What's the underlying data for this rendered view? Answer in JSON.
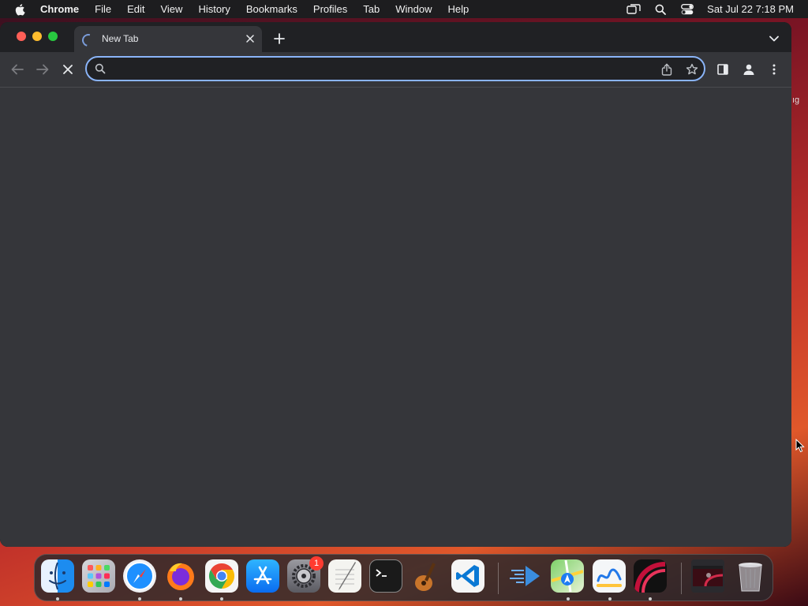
{
  "menubar": {
    "app_name": "Chrome",
    "items": [
      "File",
      "Edit",
      "View",
      "History",
      "Bookmarks",
      "Profiles",
      "Tab",
      "Window",
      "Help"
    ],
    "clock": "Sat Jul 22  7:18 PM"
  },
  "browser": {
    "tab_title": "New Tab",
    "omnibox_value": "",
    "page_state": "loading"
  },
  "desktop": {
    "edge_text": "ıg"
  },
  "dock": {
    "items": [
      {
        "name": "Finder",
        "icon": "finder-icon",
        "running": true
      },
      {
        "name": "Launchpad",
        "icon": "launchpad-icon",
        "running": false
      },
      {
        "name": "Safari",
        "icon": "safari-icon",
        "running": true
      },
      {
        "name": "Firefox",
        "icon": "firefox-icon",
        "running": true
      },
      {
        "name": "Google Chrome",
        "icon": "chrome-icon",
        "running": true
      },
      {
        "name": "App Store",
        "icon": "app-store-icon",
        "running": false
      },
      {
        "name": "System Settings",
        "icon": "system-settings-icon",
        "running": false,
        "badge": "1"
      },
      {
        "name": "TextEdit",
        "icon": "textedit-icon",
        "running": false
      },
      {
        "name": "Terminal",
        "icon": "terminal-icon",
        "running": false
      },
      {
        "name": "GarageBand",
        "icon": "garageband-icon",
        "running": false
      },
      {
        "name": "Visual Studio Code",
        "icon": "vscode-icon",
        "running": false
      },
      {
        "name": "Transloader",
        "icon": "arrow-app-icon",
        "running": false
      },
      {
        "name": "Maps",
        "icon": "maps-icon",
        "running": true
      },
      {
        "name": "Freeform",
        "icon": "freeform-icon",
        "running": true
      },
      {
        "name": "Ventura Wallpaper",
        "icon": "wallpaper-app-icon",
        "running": true
      },
      {
        "name": "Screen Recording",
        "icon": "recording-thumbnail-icon",
        "running": false
      },
      {
        "name": "Trash",
        "icon": "trash-icon",
        "running": false
      }
    ]
  },
  "colors": {
    "menubar_bg": "#1d1d1f",
    "window_bg": "#35363a",
    "tabstrip_bg": "#202124",
    "omnibox_focus": "#8ab4f8",
    "accent_blue": "#7a9cd9"
  }
}
